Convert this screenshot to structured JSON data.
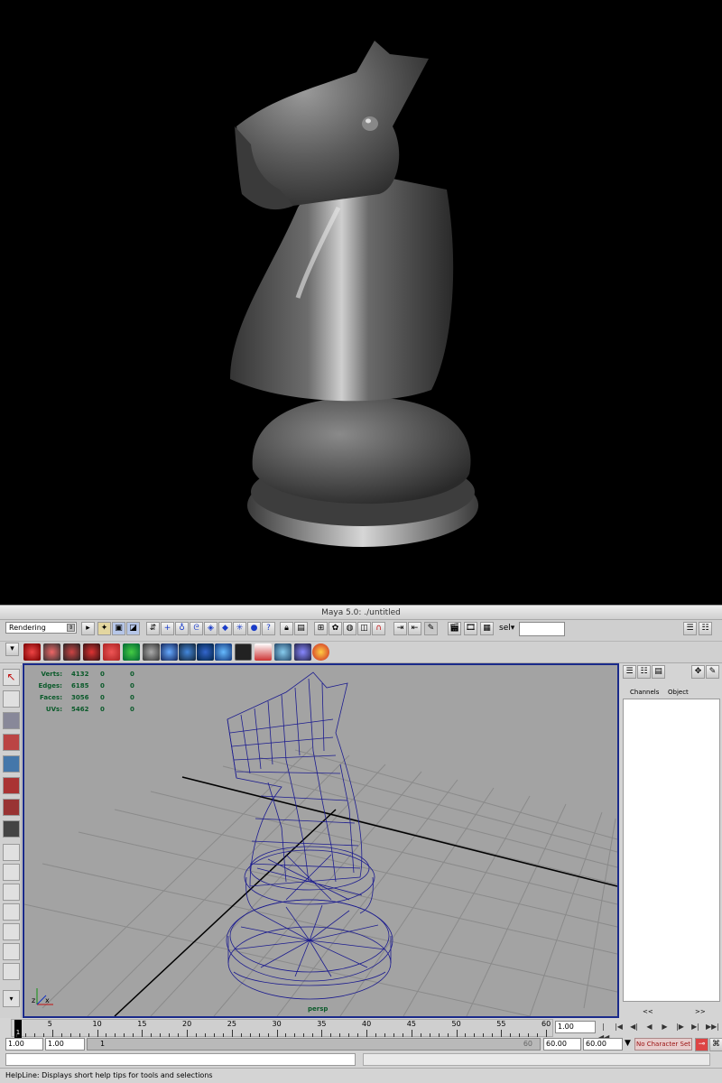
{
  "window": {
    "title": "Maya 5.0: ./untitled"
  },
  "status_line": {
    "menu_set": "Rendering",
    "selection_label": "sel▾",
    "selection_value": ""
  },
  "hud": {
    "rows": [
      {
        "label": "Verts:",
        "value": "4132",
        "a": "0",
        "b": "0"
      },
      {
        "label": "Edges:",
        "value": "6185",
        "a": "0",
        "b": "0"
      },
      {
        "label": "Faces:",
        "value": "3056",
        "a": "0",
        "b": "0"
      },
      {
        "label": "UVs:",
        "value": "5462",
        "a": "0",
        "b": "0"
      }
    ]
  },
  "viewport": {
    "camera": "persp"
  },
  "axis": {
    "x": "x",
    "z": "z"
  },
  "channel_box": {
    "tab_channels": "Channels",
    "tab_object": "Object",
    "prev": "<<",
    "next": ">>"
  },
  "time_slider": {
    "current_frame": "1",
    "ticks": [
      "5",
      "10",
      "15",
      "20",
      "25",
      "30",
      "35",
      "40",
      "45",
      "50",
      "55",
      "60"
    ],
    "current_time": "1.00",
    "buttons": [
      "|◀◀",
      "|◀",
      "◀|",
      "◀",
      "▶",
      "|▶",
      "▶|",
      "▶▶|"
    ]
  },
  "range_slider": {
    "start": "1.00",
    "playback_start": "1.00",
    "bar_start": "1",
    "bar_end": "60",
    "playback_end": "60.00",
    "end": "60.00",
    "character_set": "No Character Set"
  },
  "helpline": {
    "text": "HelpLine: Displays short help tips for tools and selections"
  },
  "colors": {
    "wire": "#1c1c8f",
    "viewport_bg": "#a3a3a3",
    "hud_text": "#0a5a2a"
  }
}
